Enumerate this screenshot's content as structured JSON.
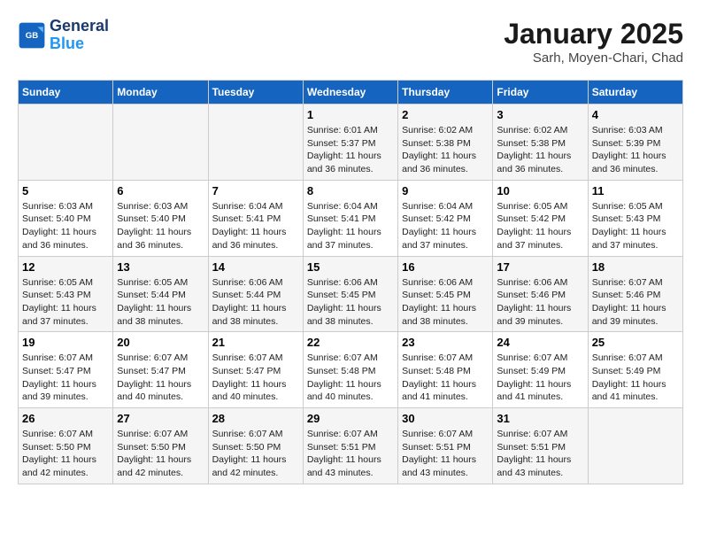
{
  "header": {
    "logo_line1": "General",
    "logo_line2": "Blue",
    "title": "January 2025",
    "subtitle": "Sarh, Moyen-Chari, Chad"
  },
  "days_of_week": [
    "Sunday",
    "Monday",
    "Tuesday",
    "Wednesday",
    "Thursday",
    "Friday",
    "Saturday"
  ],
  "weeks": [
    [
      {
        "day": "",
        "detail": ""
      },
      {
        "day": "",
        "detail": ""
      },
      {
        "day": "",
        "detail": ""
      },
      {
        "day": "1",
        "detail": "Sunrise: 6:01 AM\nSunset: 5:37 PM\nDaylight: 11 hours and 36 minutes."
      },
      {
        "day": "2",
        "detail": "Sunrise: 6:02 AM\nSunset: 5:38 PM\nDaylight: 11 hours and 36 minutes."
      },
      {
        "day": "3",
        "detail": "Sunrise: 6:02 AM\nSunset: 5:38 PM\nDaylight: 11 hours and 36 minutes."
      },
      {
        "day": "4",
        "detail": "Sunrise: 6:03 AM\nSunset: 5:39 PM\nDaylight: 11 hours and 36 minutes."
      }
    ],
    [
      {
        "day": "5",
        "detail": "Sunrise: 6:03 AM\nSunset: 5:40 PM\nDaylight: 11 hours and 36 minutes."
      },
      {
        "day": "6",
        "detail": "Sunrise: 6:03 AM\nSunset: 5:40 PM\nDaylight: 11 hours and 36 minutes."
      },
      {
        "day": "7",
        "detail": "Sunrise: 6:04 AM\nSunset: 5:41 PM\nDaylight: 11 hours and 36 minutes."
      },
      {
        "day": "8",
        "detail": "Sunrise: 6:04 AM\nSunset: 5:41 PM\nDaylight: 11 hours and 37 minutes."
      },
      {
        "day": "9",
        "detail": "Sunrise: 6:04 AM\nSunset: 5:42 PM\nDaylight: 11 hours and 37 minutes."
      },
      {
        "day": "10",
        "detail": "Sunrise: 6:05 AM\nSunset: 5:42 PM\nDaylight: 11 hours and 37 minutes."
      },
      {
        "day": "11",
        "detail": "Sunrise: 6:05 AM\nSunset: 5:43 PM\nDaylight: 11 hours and 37 minutes."
      }
    ],
    [
      {
        "day": "12",
        "detail": "Sunrise: 6:05 AM\nSunset: 5:43 PM\nDaylight: 11 hours and 37 minutes."
      },
      {
        "day": "13",
        "detail": "Sunrise: 6:05 AM\nSunset: 5:44 PM\nDaylight: 11 hours and 38 minutes."
      },
      {
        "day": "14",
        "detail": "Sunrise: 6:06 AM\nSunset: 5:44 PM\nDaylight: 11 hours and 38 minutes."
      },
      {
        "day": "15",
        "detail": "Sunrise: 6:06 AM\nSunset: 5:45 PM\nDaylight: 11 hours and 38 minutes."
      },
      {
        "day": "16",
        "detail": "Sunrise: 6:06 AM\nSunset: 5:45 PM\nDaylight: 11 hours and 38 minutes."
      },
      {
        "day": "17",
        "detail": "Sunrise: 6:06 AM\nSunset: 5:46 PM\nDaylight: 11 hours and 39 minutes."
      },
      {
        "day": "18",
        "detail": "Sunrise: 6:07 AM\nSunset: 5:46 PM\nDaylight: 11 hours and 39 minutes."
      }
    ],
    [
      {
        "day": "19",
        "detail": "Sunrise: 6:07 AM\nSunset: 5:47 PM\nDaylight: 11 hours and 39 minutes."
      },
      {
        "day": "20",
        "detail": "Sunrise: 6:07 AM\nSunset: 5:47 PM\nDaylight: 11 hours and 40 minutes."
      },
      {
        "day": "21",
        "detail": "Sunrise: 6:07 AM\nSunset: 5:47 PM\nDaylight: 11 hours and 40 minutes."
      },
      {
        "day": "22",
        "detail": "Sunrise: 6:07 AM\nSunset: 5:48 PM\nDaylight: 11 hours and 40 minutes."
      },
      {
        "day": "23",
        "detail": "Sunrise: 6:07 AM\nSunset: 5:48 PM\nDaylight: 11 hours and 41 minutes."
      },
      {
        "day": "24",
        "detail": "Sunrise: 6:07 AM\nSunset: 5:49 PM\nDaylight: 11 hours and 41 minutes."
      },
      {
        "day": "25",
        "detail": "Sunrise: 6:07 AM\nSunset: 5:49 PM\nDaylight: 11 hours and 41 minutes."
      }
    ],
    [
      {
        "day": "26",
        "detail": "Sunrise: 6:07 AM\nSunset: 5:50 PM\nDaylight: 11 hours and 42 minutes."
      },
      {
        "day": "27",
        "detail": "Sunrise: 6:07 AM\nSunset: 5:50 PM\nDaylight: 11 hours and 42 minutes."
      },
      {
        "day": "28",
        "detail": "Sunrise: 6:07 AM\nSunset: 5:50 PM\nDaylight: 11 hours and 42 minutes."
      },
      {
        "day": "29",
        "detail": "Sunrise: 6:07 AM\nSunset: 5:51 PM\nDaylight: 11 hours and 43 minutes."
      },
      {
        "day": "30",
        "detail": "Sunrise: 6:07 AM\nSunset: 5:51 PM\nDaylight: 11 hours and 43 minutes."
      },
      {
        "day": "31",
        "detail": "Sunrise: 6:07 AM\nSunset: 5:51 PM\nDaylight: 11 hours and 43 minutes."
      },
      {
        "day": "",
        "detail": ""
      }
    ]
  ]
}
